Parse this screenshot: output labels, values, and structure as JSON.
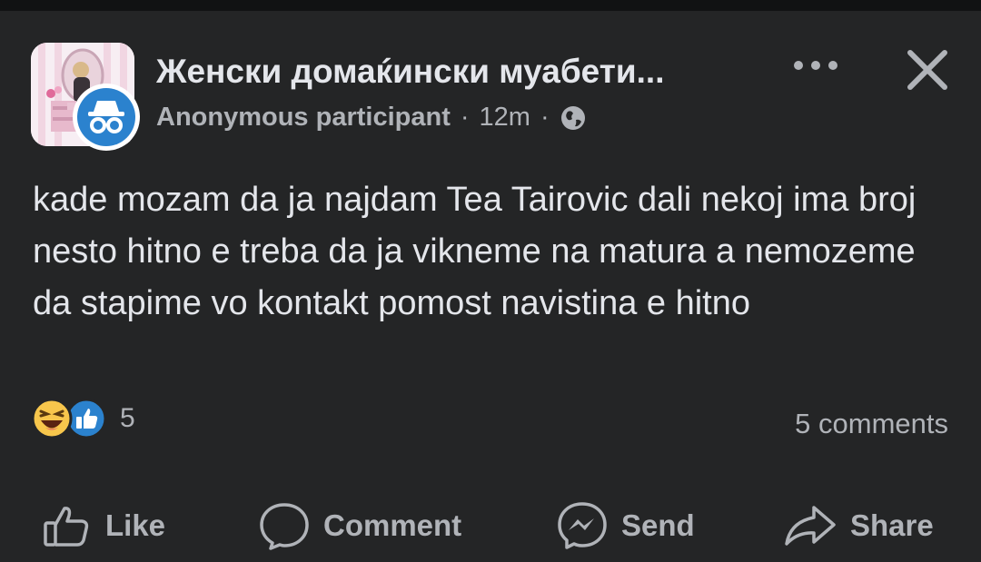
{
  "post": {
    "group_name": "Женски домаќински муабети...",
    "author": "Anonymous participant",
    "separator": "·",
    "time": "12m",
    "body": "kade mozam da ja najdam Tea Tairovic dali nekoj ima broj nesto hitno e treba da ja vikneme na matura a nemozeme da stapime vo kontakt pomost navistina e hitno",
    "reactions_count": "5",
    "comments_label": "5 comments"
  },
  "actions": {
    "like": "Like",
    "comment": "Comment",
    "send": "Send",
    "share": "Share"
  },
  "icons": {
    "more": "more-horizontal-icon",
    "close": "close-icon",
    "privacy": "globe-icon",
    "anonymous": "anonymous-spy-icon",
    "reaction_1": "haha-reaction-icon",
    "reaction_2": "like-reaction-icon"
  },
  "colors": {
    "background": "#242526",
    "text_primary": "#e4e6eb",
    "text_secondary": "#b0b3b8",
    "like_blue": "#2b82ce",
    "haha_yellow": "#f7c64c"
  }
}
